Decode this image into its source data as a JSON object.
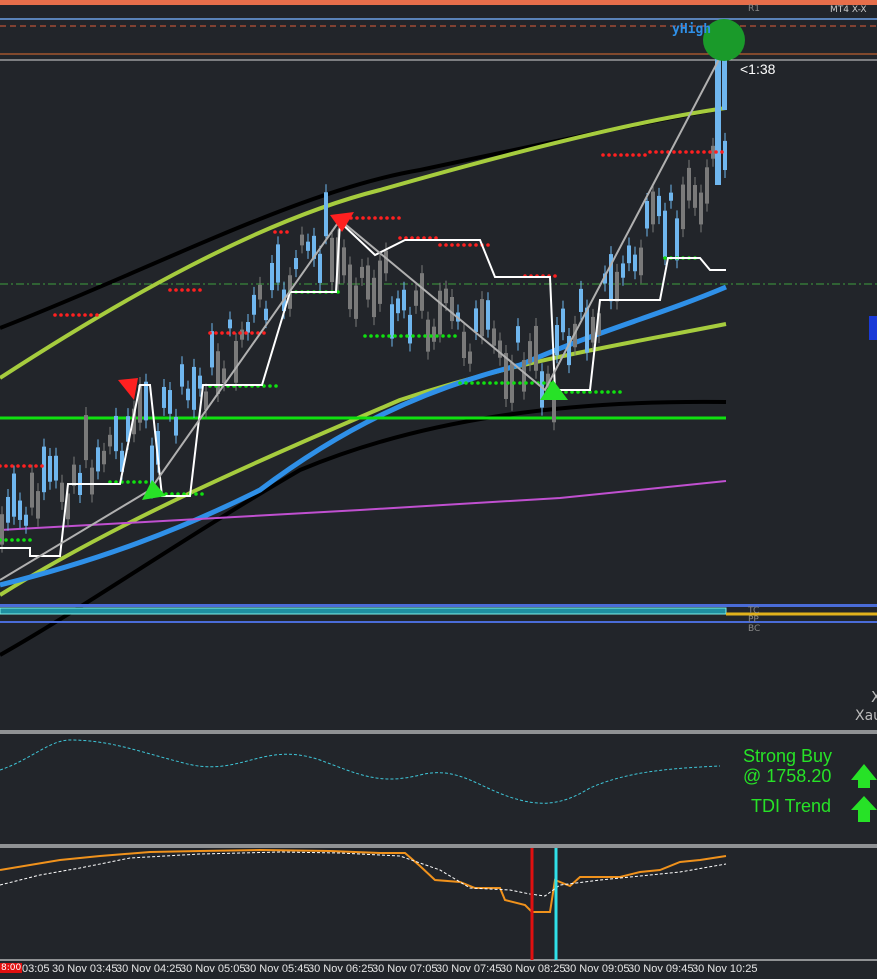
{
  "platform_label": "MT4 X-X",
  "pivot_labels": {
    "r1": "R1",
    "tc": "TC",
    "pp": "PP",
    "bc": "BC"
  },
  "yhigh_label": "yHigh",
  "timer_label": "<1:38",
  "side_label": "Xau",
  "side_label_x": "X",
  "signals": {
    "strong_buy": "Strong Buy",
    "price": "@ 1758.20",
    "tdi_trend": "TDI Trend",
    "color": "#27e227"
  },
  "time_axis": {
    "first_tick_label": "8:00",
    "labels": [
      "03:05",
      "30 Nov 03:45",
      "30 Nov 04:25",
      "30 Nov 05:05",
      "30 Nov 05:45",
      "30 Nov 06:25",
      "30 Nov 07:05",
      "30 Nov 07:45",
      "30 Nov 08:25",
      "30 Nov 09:05",
      "30 Nov 09:45",
      "30 Nov 10:25"
    ]
  },
  "colors": {
    "background": "#22252a",
    "bull_candle": "#6fb6ee",
    "bear_candle": "#7a7a7a",
    "signal_buy": "#27e227",
    "signal_sell": "#ff2020",
    "ma_fast": "#2f90e8",
    "ma_slow": "#a6cc3e",
    "envelope": "#000000",
    "support_line": "#10e010",
    "magenta_line": "#c050d0",
    "tdi_orange": "#f0921c"
  }
}
